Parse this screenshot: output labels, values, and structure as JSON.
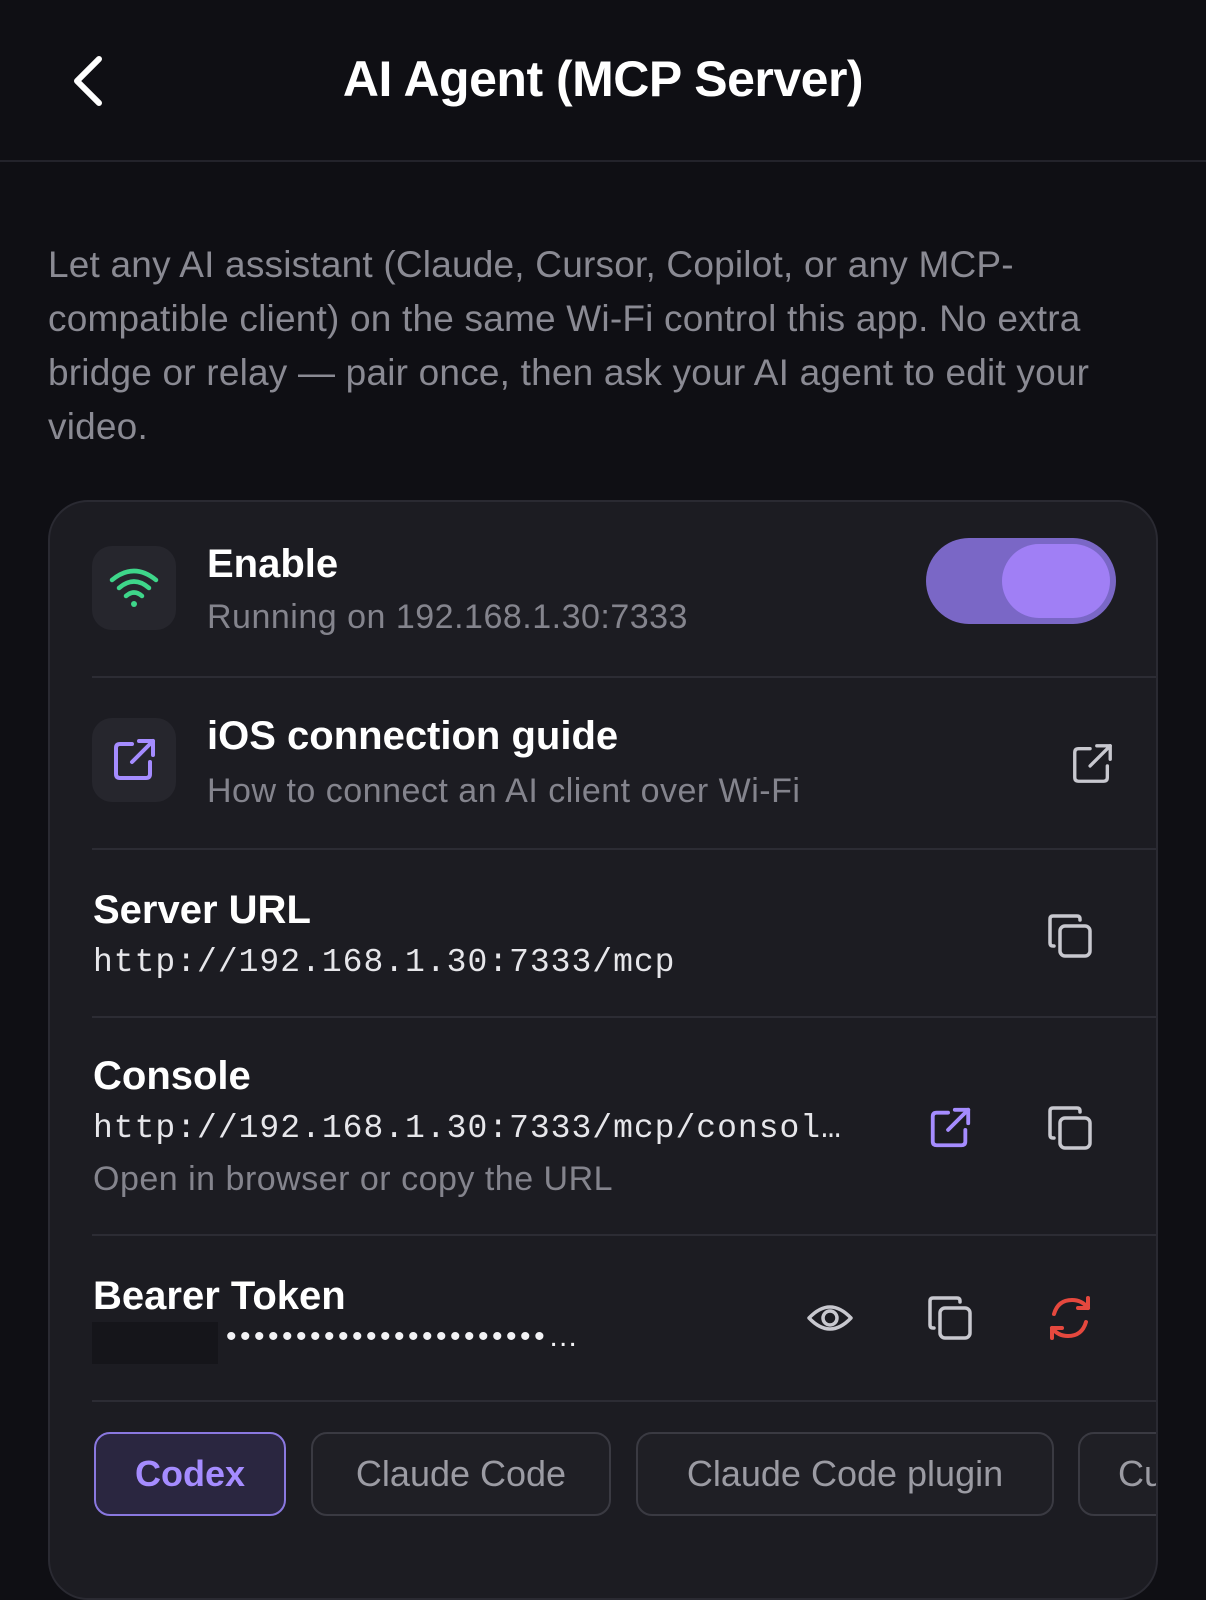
{
  "header": {
    "title": "AI Agent (MCP Server)",
    "back_icon": "chevron-left-icon"
  },
  "description": "Let any AI assistant (Claude, Cursor, Copilot, or any MCP-compatible client) on the same Wi-Fi control this app. No extra bridge or relay — pair once, then ask your AI agent to edit your video.",
  "enable_row": {
    "title": "Enable",
    "subtitle": "Running on 192.168.1.30:7333",
    "icon": "wifi-icon",
    "icon_color": "#3ed68a",
    "toggle_on": true,
    "toggle_color": "#7a67c6"
  },
  "guide_row": {
    "title": "iOS connection guide",
    "subtitle": "How to connect an AI client over Wi-Fi",
    "icon": "external-link-icon",
    "icon_color": "#a58cff"
  },
  "server_url_row": {
    "title": "Server URL",
    "value": "http://192.168.1.30:7333/mcp",
    "copy_icon": "copy-icon"
  },
  "console_row": {
    "title": "Console",
    "value": "http://192.168.1.30:7333/mcp/consol…",
    "subtitle": "Open in browser or copy the URL",
    "open_icon": "external-link-icon",
    "copy_icon": "copy-icon"
  },
  "token_row": {
    "title": "Bearer Token",
    "masked_value": "•••••••••••••••••••••••…",
    "reveal_icon": "eye-icon",
    "copy_icon": "copy-icon",
    "regenerate_icon": "refresh-icon",
    "regenerate_color": "#e5483e"
  },
  "client_tabs": [
    {
      "label": "Codex",
      "active": true
    },
    {
      "label": "Claude Code",
      "active": false
    },
    {
      "label": "Claude Code plugin",
      "active": false
    },
    {
      "label": "Cu",
      "active": false
    }
  ],
  "colors": {
    "background": "#0f0f14",
    "card": "#1c1c22",
    "accent": "#a58cff"
  }
}
